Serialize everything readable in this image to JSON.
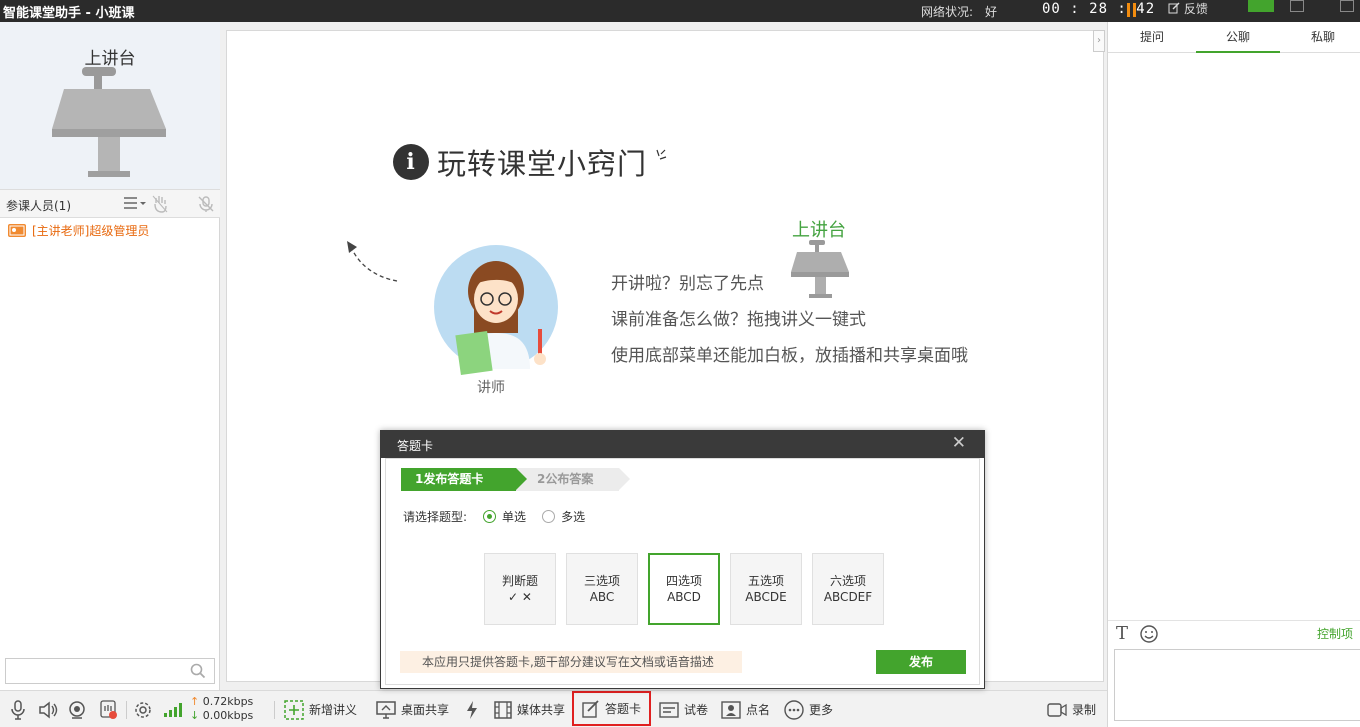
{
  "titlebar": {
    "app_title": "智能课堂助手 - 小班课",
    "network_label": "网络状况:",
    "network_value": "好",
    "timer": "00 : 28 : 42",
    "feedback_label": "反馈"
  },
  "left": {
    "podium_title": "上讲台",
    "members_label": "参课人员(1)",
    "members": [
      {
        "name": "[主讲老师]超级管理员"
      }
    ],
    "search_placeholder": ""
  },
  "stage": {
    "tips_title": "玩转课堂小窍门",
    "podium_label": "上讲台",
    "teacher_label": "讲师",
    "tips": [
      "开讲啦？别忘了先点",
      "课前准备怎么做？拖拽讲义一键式",
      "使用底部菜单还能加白板，放插播和共享桌面哦"
    ]
  },
  "right": {
    "tabs": [
      "提问",
      "公聊",
      "私聊"
    ],
    "active_tab": 1,
    "control_link": "控制项"
  },
  "toolbar": {
    "speed_up": "0.72kbps",
    "speed_down": "0.00kbps",
    "new_doc": "新增讲义",
    "desktop_share": "桌面共享",
    "media_share": "媒体共享",
    "answer_card": "答题卡",
    "exam": "试卷",
    "roll_call": "点名",
    "more": "更多",
    "record": "录制"
  },
  "dialog": {
    "title": "答题卡",
    "step1": "1发布答题卡",
    "step2": "2公布答案",
    "question_type_label": "请选择题型:",
    "single": "单选",
    "multi": "多选",
    "cards": [
      {
        "line1": "判断题",
        "line2": "✓ ✕"
      },
      {
        "line1": "三选项",
        "line2": "ABC"
      },
      {
        "line1": "四选项",
        "line2": "ABCD"
      },
      {
        "line1": "五选项",
        "line2": "ABCDE"
      },
      {
        "line1": "六选项",
        "line2": "ABCDEF"
      }
    ],
    "selected_card": 2,
    "notice": "本应用只提供答题卡,题干部分建议写在文档或语音描述",
    "publish": "发布"
  },
  "colors": {
    "accent_green": "#43a42d",
    "title_bar": "#2b2b2b",
    "highlight_red": "#e02020",
    "teacher_orange": "#e86a10"
  }
}
